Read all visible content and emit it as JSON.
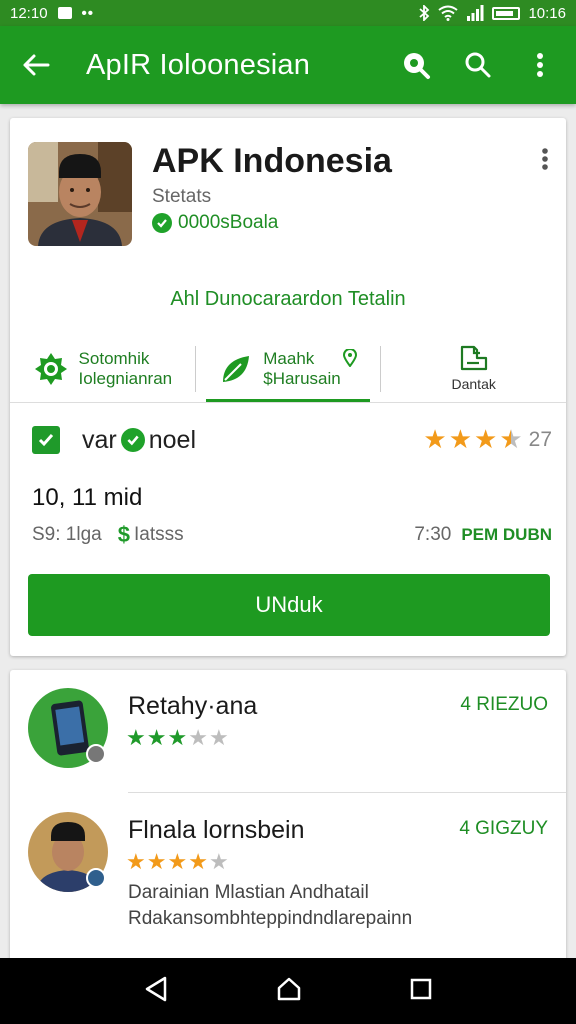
{
  "status_bar": {
    "time_left": "12:10",
    "dots": "••",
    "time_right": "10:16"
  },
  "app_bar": {
    "title": "ApIR Ioloonesian"
  },
  "app": {
    "name": "APK  Indonesia",
    "subtitle": "Stetats",
    "verified_text": "0000sBoala",
    "tagline": "Ahl Dunocaraardon Tetalin"
  },
  "tabs": [
    {
      "label": "Sotomhik\nIolegnianran",
      "active": false
    },
    {
      "label": "Maahk\n$Harusain",
      "active": true
    },
    {
      "label": "Dantak",
      "active": false
    }
  ],
  "variant": {
    "prefix": "var",
    "suffix": "noel",
    "rating_count": "27",
    "rating_stars": 3.5
  },
  "size": "10, 11 mid",
  "price": {
    "left": "S9: 1lga",
    "dollar": "$",
    "right": "Iatsss",
    "time": "7:30",
    "when": "PEM DUBN"
  },
  "download_label": "UNduk",
  "reviews": [
    {
      "name": "Retahy·ana",
      "date": "4 RIEZUO",
      "stars": 3,
      "text1": "",
      "text2": ""
    },
    {
      "name": "Flnаla lornsbein",
      "date": "4 GIGZUY",
      "stars": 4,
      "text1": "Darainian Mlastian Andhatail",
      "text2": "Rdakansombhteppindndlarepainn"
    }
  ],
  "colors": {
    "brand": "#1e9a21",
    "star_orange": "#f29a1a",
    "star_green": "#1f9a2a",
    "star_grey": "#bdbdbd"
  }
}
